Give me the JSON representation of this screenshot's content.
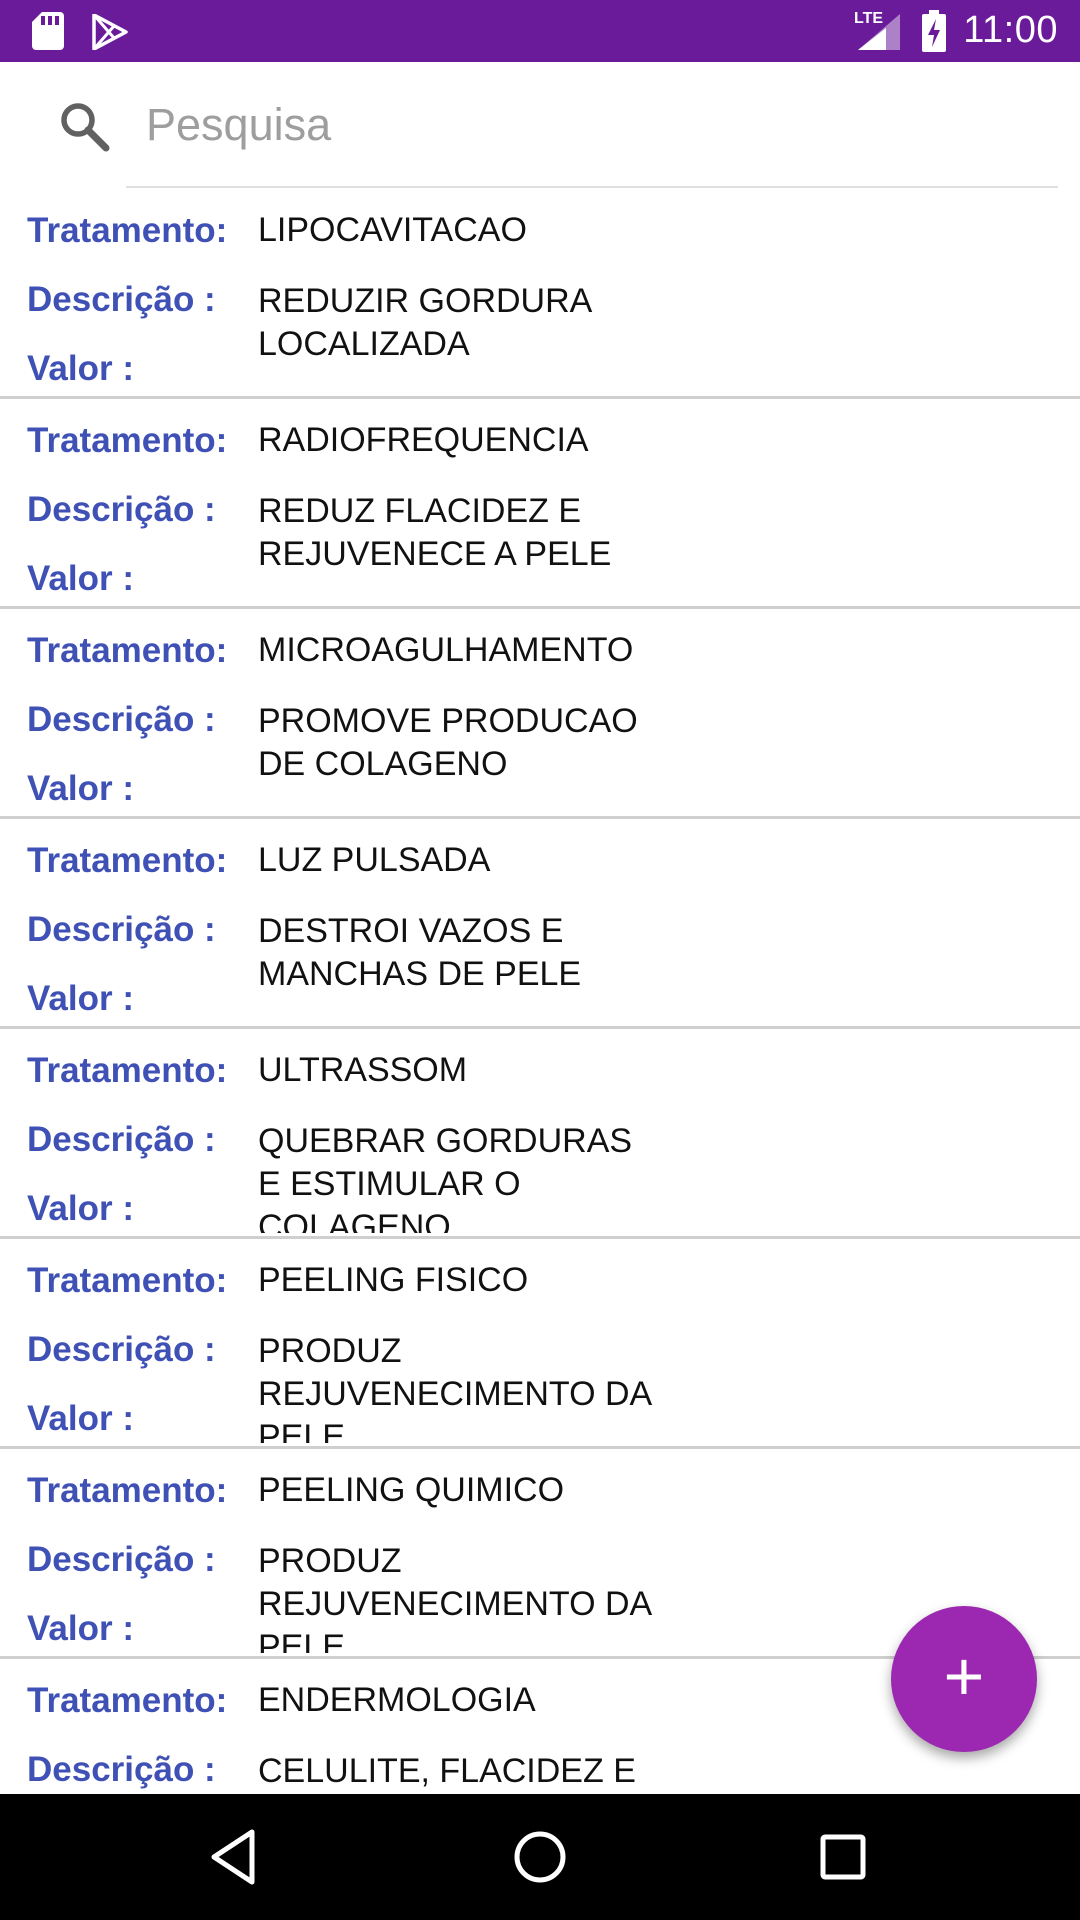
{
  "status_bar": {
    "time": "11:00",
    "network": "LTE",
    "icons": [
      "sd-card-icon",
      "play-store-icon",
      "signal-icon",
      "battery-charging-icon"
    ],
    "background_color": "#6a1b9a"
  },
  "search": {
    "placeholder": "Pesquisa",
    "value": "",
    "icon": "search-icon"
  },
  "labels": {
    "treatment": "Tratamento:",
    "description": "Descrição :",
    "value": "Valor :"
  },
  "items": [
    {
      "name": "LIPOCAVITACAO",
      "description": "REDUZIR GORDURA LOCALIZADA",
      "value": ""
    },
    {
      "name": "RADIOFREQUENCIA",
      "description": "REDUZ FLACIDEZ E REJUVENECE A PELE",
      "value": ""
    },
    {
      "name": "MICROAGULHAMENTO",
      "description": "PROMOVE PRODUCAO DE COLAGENO",
      "value": ""
    },
    {
      "name": "LUZ PULSADA",
      "description": "DESTROI VAZOS E MANCHAS DE PELE",
      "value": ""
    },
    {
      "name": "ULTRASSOM",
      "description": "QUEBRAR GORDURAS E ESTIMULAR O COLAGENO",
      "value": ""
    },
    {
      "name": "PEELING FISICO",
      "description": "PRODUZ REJUVENECIMENTO DA PELE",
      "value": ""
    },
    {
      "name": "PEELING QUIMICO",
      "description": "PRODUZ REJUVENECIMENTO DA PELE",
      "value": ""
    },
    {
      "name": "ENDERMOLOGIA",
      "description": "CELULITE, FLACIDEZ E",
      "value": ""
    }
  ],
  "fab": {
    "label": "+",
    "icon": "add-icon",
    "color": "#9c27b0"
  },
  "colors": {
    "label": "#3f51b5",
    "text": "#111111"
  },
  "navigation": {
    "buttons": [
      "back-icon",
      "home-icon",
      "recents-icon"
    ]
  }
}
